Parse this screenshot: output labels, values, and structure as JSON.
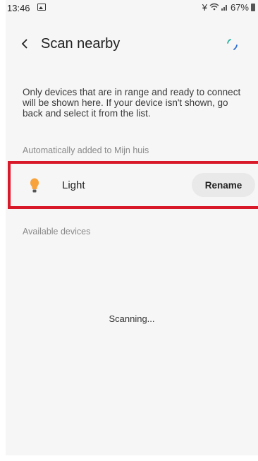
{
  "status_bar": {
    "time": "13:46",
    "battery": "67%"
  },
  "header": {
    "title": "Scan nearby"
  },
  "description": "Only devices that are in range and ready to connect will be shown here. If your device isn't shown, go back and select it from the list.",
  "auto_added": {
    "label": "Automatically added to Mijn huis",
    "devices": [
      {
        "name": "Light",
        "icon": "bulb-icon",
        "action": "Rename"
      }
    ]
  },
  "available": {
    "label": "Available devices",
    "status": "Scanning..."
  },
  "colors": {
    "highlight": "#d7192a",
    "bulb": "#f7a23b",
    "background": "#f6f6f6"
  }
}
